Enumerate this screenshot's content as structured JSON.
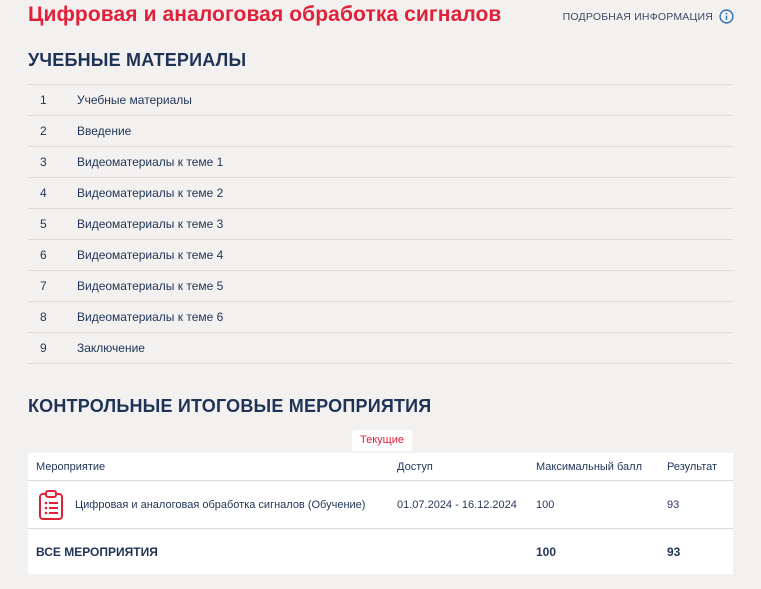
{
  "header": {
    "title": "Цифровая и аналоговая обработка сигналов",
    "more_info_label": "ПОДРОБНАЯ ИНФОРМАЦИЯ"
  },
  "materials": {
    "title": "УЧЕБНЫЕ МАТЕРИАЛЫ",
    "items": [
      {
        "num": "1",
        "label": "Учебные материалы"
      },
      {
        "num": "2",
        "label": "Введение"
      },
      {
        "num": "3",
        "label": "Видеоматериалы к теме 1"
      },
      {
        "num": "4",
        "label": "Видеоматериалы к теме 2"
      },
      {
        "num": "5",
        "label": "Видеоматериалы к теме 3"
      },
      {
        "num": "6",
        "label": "Видеоматериалы к теме 4"
      },
      {
        "num": "7",
        "label": "Видеоматериалы к теме 5"
      },
      {
        "num": "8",
        "label": "Видеоматериалы к теме 6"
      },
      {
        "num": "9",
        "label": "Заключение"
      }
    ]
  },
  "events": {
    "title": "КОНТРОЛЬНЫЕ ИТОГОВЫЕ МЕРОПРИЯТИЯ",
    "tab_current": "Текущие",
    "columns": [
      "Мероприятие",
      "Доступ",
      "Максимальный балл",
      "Результат"
    ],
    "rows": [
      {
        "name": "Цифровая и аналоговая обработка сигналов (Обучение)",
        "access": "01.07.2024 - 16.12.2024",
        "max_score": "100",
        "result": "93"
      }
    ],
    "total": {
      "label": "ВСЕ МЕРОПРИЯТИЯ",
      "max_score": "100",
      "result": "93"
    }
  },
  "colors": {
    "accent": "#e1213a",
    "primary_text": "#1f3357",
    "background": "#f2f1ef"
  },
  "icons": {
    "info": "info-circle-icon",
    "event": "clipboard-checklist-icon"
  }
}
